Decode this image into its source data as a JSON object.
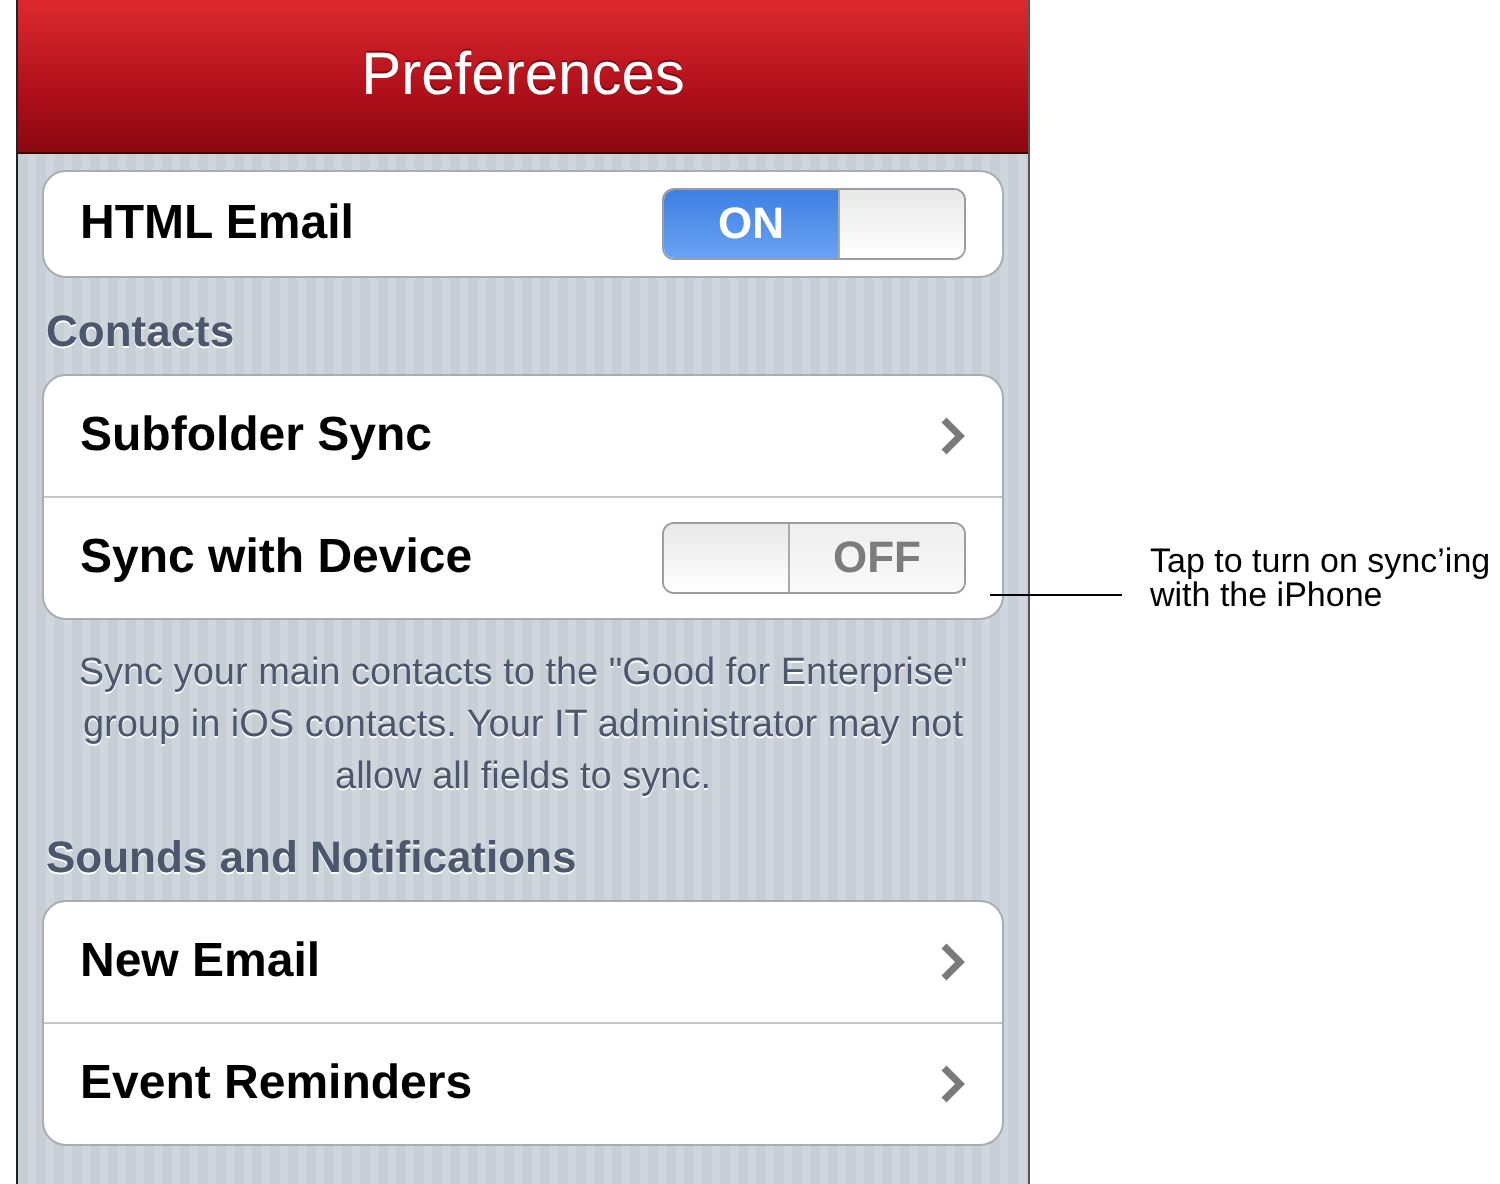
{
  "header": {
    "title": "Preferences"
  },
  "groups": [
    {
      "rows": [
        {
          "label": "HTML Email",
          "kind": "toggle",
          "on": true,
          "toggle_text": "ON"
        }
      ]
    },
    {
      "title": "Contacts",
      "rows": [
        {
          "label": "Subfolder Sync",
          "kind": "link"
        },
        {
          "label": "Sync with Device",
          "kind": "toggle",
          "on": false,
          "toggle_text": "OFF"
        }
      ],
      "footer": "Sync your main contacts to the \"Good for Enterprise\" group in iOS contacts. Your IT administrator may not allow all fields to sync."
    },
    {
      "title": "Sounds and Notifications",
      "rows": [
        {
          "label": "New Email",
          "kind": "link"
        },
        {
          "label": "Event Reminders",
          "kind": "link"
        }
      ]
    }
  ],
  "annotation": {
    "text": "Tap to turn on sync’ing with the iPhone"
  }
}
